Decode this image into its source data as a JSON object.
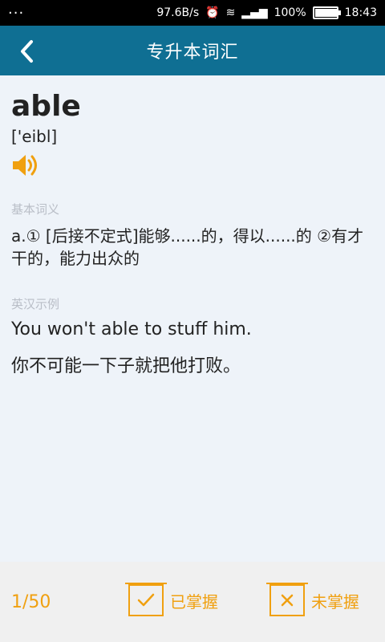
{
  "status_bar": {
    "left": "···",
    "network_speed": "97.6B/s",
    "battery_percent": "100%",
    "time": "18:43"
  },
  "header": {
    "title": "专升本词汇"
  },
  "word": {
    "text": "able",
    "phonetic": "['eibl]"
  },
  "basic_meaning": {
    "label": "基本词义",
    "text": "a.① [后接不定式]能够......的，得以......的 ②有才干的，能力出众的"
  },
  "example": {
    "label": "英汉示例",
    "en": "You won't able to stuff him.",
    "zh": "你不可能一下子就把他打败。"
  },
  "footer": {
    "counter": "1/50",
    "mastered_label": "已掌握",
    "not_mastered_label": "未掌握"
  },
  "colors": {
    "header_bg": "#0f6f93",
    "accent": "#f0a010",
    "content_bg": "#eef3f9"
  }
}
